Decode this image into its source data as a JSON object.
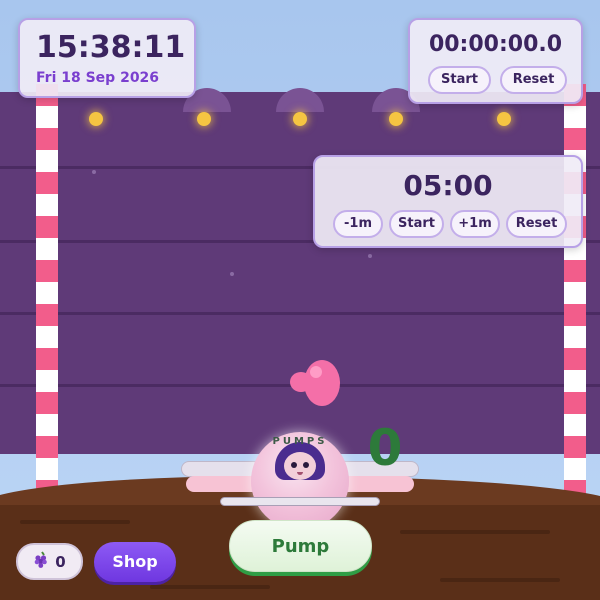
{
  "clock": {
    "time": "15:38:11",
    "date": "Fri 18 Sep 2026"
  },
  "stopwatch": {
    "time": "00:00:00.0",
    "start_label": "Start",
    "reset_label": "Reset"
  },
  "timer": {
    "time": "05:00",
    "minus_label": "-1m",
    "start_label": "Start",
    "plus_label": "+1m",
    "reset_label": "Reset"
  },
  "game": {
    "pumps_label": "PUMPS",
    "pumps_count": "0"
  },
  "bottom": {
    "grape_icon": "grape-icon",
    "grape_count": "0",
    "shop_label": "Shop",
    "pump_label": "Pump"
  },
  "colors": {
    "accent": "#7a3fcf",
    "shop": "#7b45ea",
    "pump_text": "#2d7a3a",
    "wall": "#5f3a78",
    "post_stripe": "#f25d8b"
  }
}
